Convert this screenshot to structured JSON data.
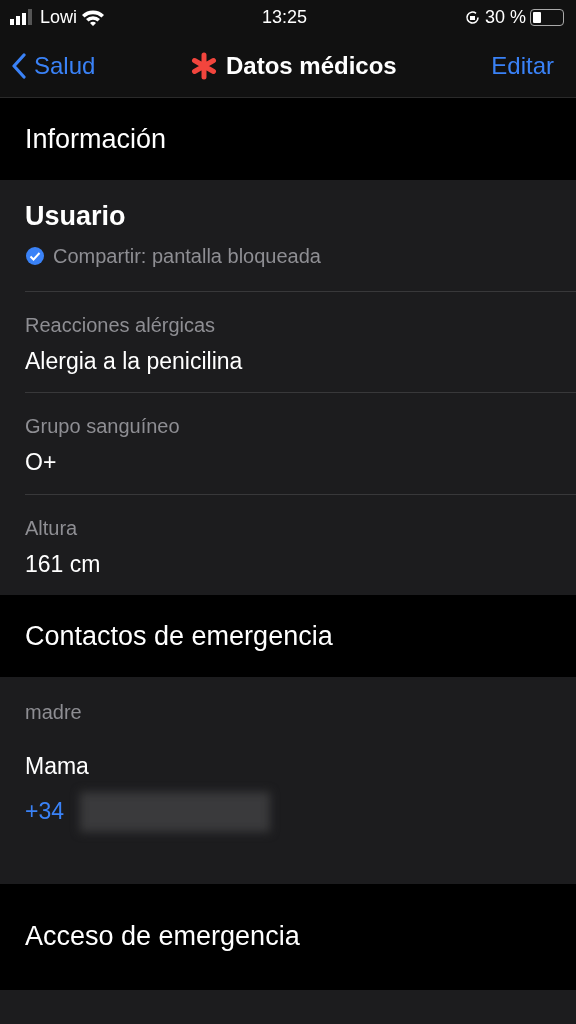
{
  "status_bar": {
    "carrier": "Lowi",
    "time": "13:25",
    "battery": "30 %"
  },
  "nav": {
    "back": "Salud",
    "title": "Datos médicos",
    "action": "Editar"
  },
  "sections": [
    {
      "header": "Información",
      "kind": "profile",
      "name": "Usuario",
      "share": "Compartir: pantalla bloqueada",
      "share_checked": true,
      "fields": [
        {
          "label": "Reacciones alérgicas",
          "value": "Alergia a la penicilina"
        },
        {
          "label": "Grupo sanguíneo",
          "value": "O+"
        },
        {
          "label": "Altura",
          "value": "161 cm"
        }
      ]
    },
    {
      "header": "Contactos de emergencia",
      "kind": "contacts",
      "contacts": [
        {
          "relation": "madre",
          "name": "Mama",
          "phone": "+34"
        }
      ]
    },
    {
      "header": "Acceso de emergencia",
      "kind": "empty"
    }
  ]
}
